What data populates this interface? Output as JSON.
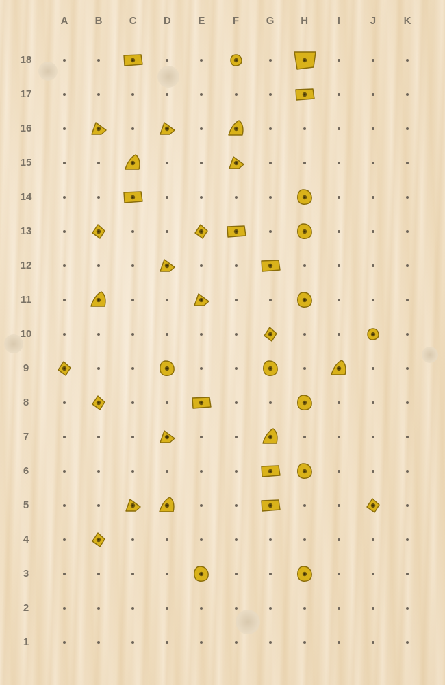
{
  "board": {
    "columns": [
      "A",
      "B",
      "C",
      "D",
      "E",
      "F",
      "G",
      "H",
      "I",
      "J",
      "K"
    ],
    "rows": [
      "18",
      "17",
      "16",
      "15",
      "14",
      "13",
      "12",
      "11",
      "10",
      "9",
      "8",
      "7",
      "6",
      "5",
      "4",
      "3",
      "2",
      "1"
    ],
    "hold_color": "#d9b21a",
    "holds": [
      {
        "pos": "C18",
        "shape": "rect-wide"
      },
      {
        "pos": "F18",
        "shape": "round-small"
      },
      {
        "pos": "H18",
        "shape": "big-jug"
      },
      {
        "pos": "H17",
        "shape": "rect-wide"
      },
      {
        "pos": "B16",
        "shape": "triangle"
      },
      {
        "pos": "D16",
        "shape": "triangle"
      },
      {
        "pos": "F16",
        "shape": "sloper"
      },
      {
        "pos": "C15",
        "shape": "sloper"
      },
      {
        "pos": "F15",
        "shape": "triangle"
      },
      {
        "pos": "C14",
        "shape": "rect-wide"
      },
      {
        "pos": "H14",
        "shape": "round"
      },
      {
        "pos": "B13",
        "shape": "diamond"
      },
      {
        "pos": "E13",
        "shape": "diamond"
      },
      {
        "pos": "F13",
        "shape": "rect-wide"
      },
      {
        "pos": "H13",
        "shape": "round"
      },
      {
        "pos": "D12",
        "shape": "triangle"
      },
      {
        "pos": "G12",
        "shape": "rect-wide"
      },
      {
        "pos": "B11",
        "shape": "sloper"
      },
      {
        "pos": "E11",
        "shape": "triangle"
      },
      {
        "pos": "H11",
        "shape": "round"
      },
      {
        "pos": "G10",
        "shape": "diamond"
      },
      {
        "pos": "J10",
        "shape": "round-small"
      },
      {
        "pos": "A9",
        "shape": "diamond"
      },
      {
        "pos": "D9",
        "shape": "round"
      },
      {
        "pos": "G9",
        "shape": "round"
      },
      {
        "pos": "I9",
        "shape": "sloper"
      },
      {
        "pos": "B8",
        "shape": "diamond"
      },
      {
        "pos": "E8",
        "shape": "rect-wide"
      },
      {
        "pos": "H8",
        "shape": "round"
      },
      {
        "pos": "D7",
        "shape": "triangle"
      },
      {
        "pos": "G7",
        "shape": "sloper"
      },
      {
        "pos": "G6",
        "shape": "rect-wide"
      },
      {
        "pos": "H6",
        "shape": "round"
      },
      {
        "pos": "C5",
        "shape": "triangle"
      },
      {
        "pos": "D5",
        "shape": "sloper"
      },
      {
        "pos": "G5",
        "shape": "rect-wide"
      },
      {
        "pos": "J5",
        "shape": "diamond"
      },
      {
        "pos": "B4",
        "shape": "diamond"
      },
      {
        "pos": "E3",
        "shape": "round"
      },
      {
        "pos": "H3",
        "shape": "round"
      }
    ]
  }
}
